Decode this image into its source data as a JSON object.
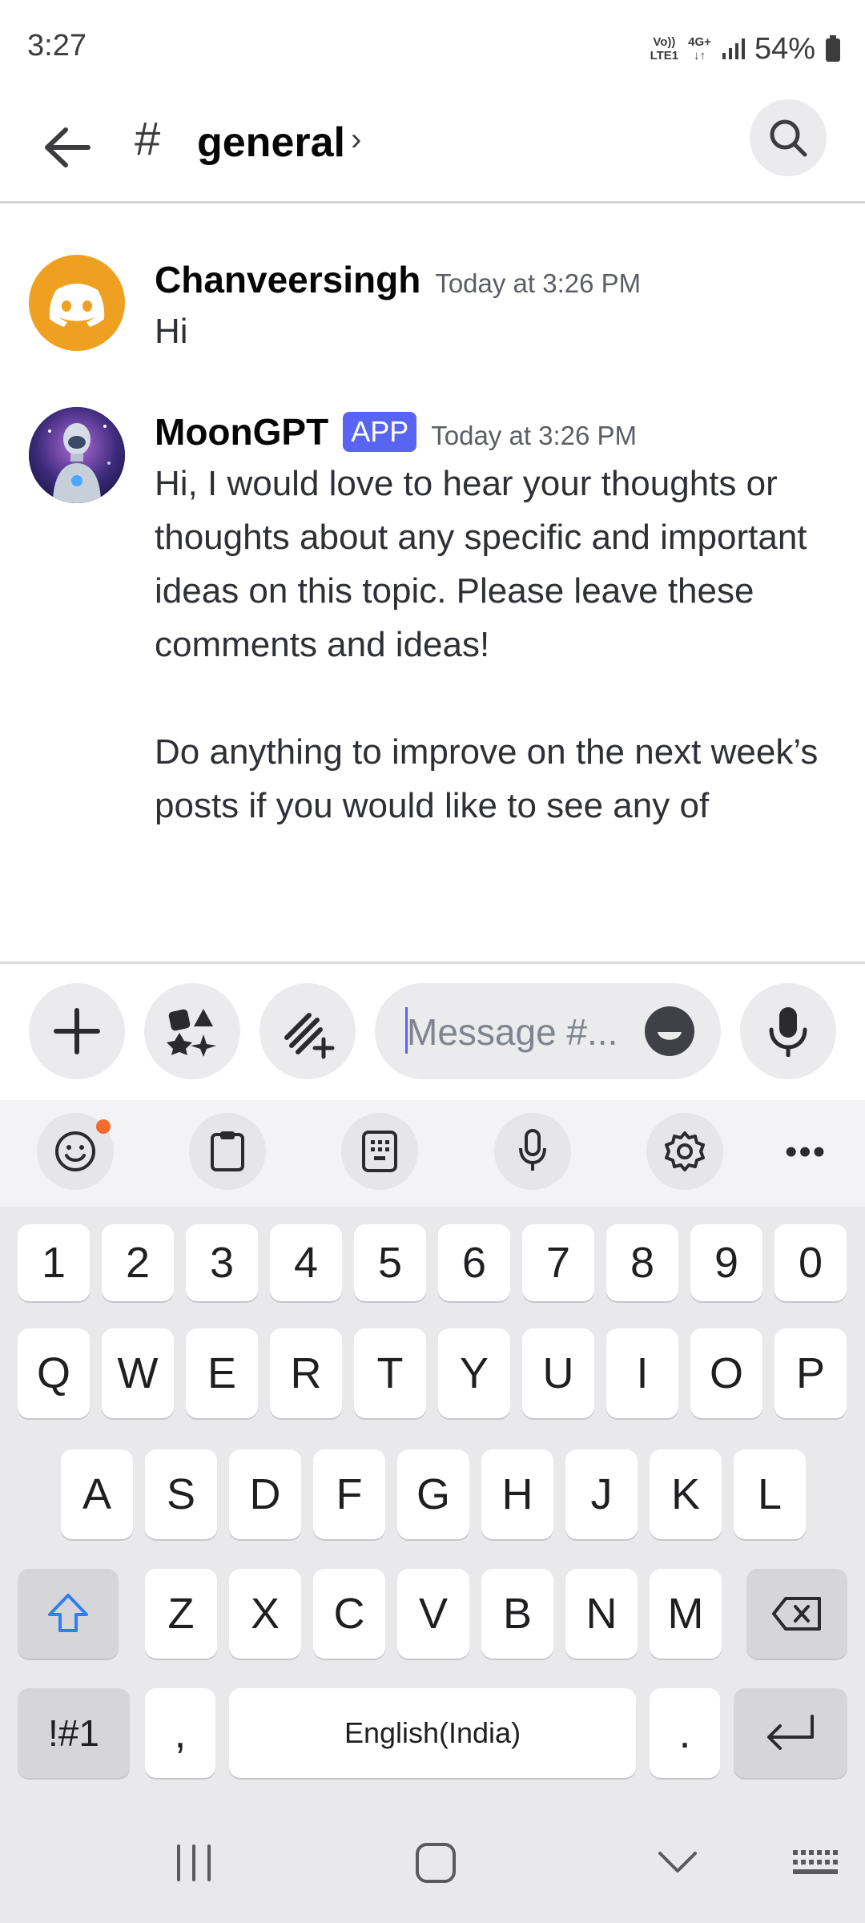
{
  "status_bar": {
    "time": "3:27",
    "volte_top": "Vo))",
    "volte_bottom": "LTE1",
    "network_type": "4G+",
    "battery_percent": "54%"
  },
  "header": {
    "channel_hash": "#",
    "channel_name": "general",
    "chevron": "›",
    "back_icon": "arrow-left-icon",
    "search_icon": "search-icon"
  },
  "messages": [
    {
      "username": "Chanveersingh",
      "timestamp": "Today at 3:26 PM",
      "body": "Hi",
      "avatar_color": "#f0a020",
      "avatar_icon": "discord-logo-icon"
    },
    {
      "username": "MoonGPT",
      "badge": "APP",
      "timestamp": "Today at 3:26 PM",
      "body_paragraph_1": "Hi, I would love to hear your thoughts or thoughts about any specific and important ideas on this topic. Please leave these comments and ideas!",
      "body_paragraph_2": "Do anything to improve on the next week’s posts if you would like to see any of",
      "avatar_icon": "robot-avatar-icon"
    }
  ],
  "composer": {
    "placeholder": "Message #...",
    "plus_icon": "plus-icon",
    "apps_icon": "apps-icon",
    "activities_icon": "slash-commands-icon",
    "emoji_icon": "emoji-icon",
    "mic_icon": "microphone-icon"
  },
  "keyboard": {
    "toolbar": [
      "emoji-icon",
      "clipboard-icon",
      "keypad-icon",
      "microphone-icon",
      "settings-icon"
    ],
    "more": "•••",
    "row_numbers": [
      "1",
      "2",
      "3",
      "4",
      "5",
      "6",
      "7",
      "8",
      "9",
      "0"
    ],
    "row_1": [
      "Q",
      "W",
      "E",
      "R",
      "T",
      "Y",
      "U",
      "I",
      "O",
      "P"
    ],
    "row_2": [
      "A",
      "S",
      "D",
      "F",
      "G",
      "H",
      "J",
      "K",
      "L"
    ],
    "row_3": [
      "Z",
      "X",
      "C",
      "V",
      "B",
      "N",
      "M"
    ],
    "symbols_key": "!#1",
    "comma_key": ",",
    "space_key": "English(India)",
    "period_key": ".",
    "accent_color": "#2f7ef6"
  },
  "colors": {
    "brand": "#5865f2",
    "notification_dot": "#f26a2e"
  }
}
